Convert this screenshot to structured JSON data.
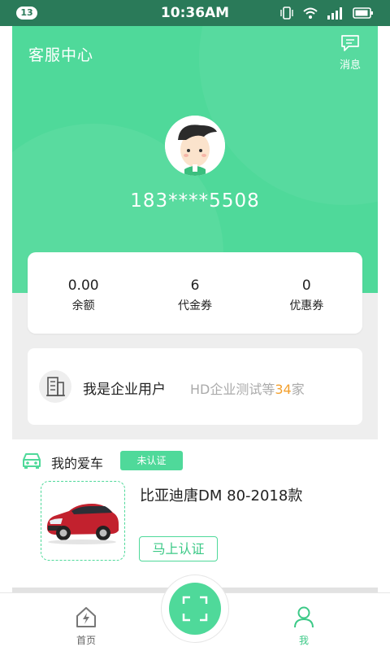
{
  "status_bar": {
    "notification_count": "13",
    "time": "10:36AM",
    "icons": [
      "vibrate-icon",
      "wifi-icon",
      "signal-icon",
      "battery-icon"
    ]
  },
  "header": {
    "service_center": "客服中心",
    "messages_label": "消息",
    "phone_masked": "183****5508",
    "background_color": "#4fd99a"
  },
  "stats": [
    {
      "value": "0.00",
      "label": "余额"
    },
    {
      "value": "6",
      "label": "代金券"
    },
    {
      "value": "0",
      "label": "优惠券"
    }
  ],
  "enterprise": {
    "title": "我是企业用户",
    "desc_prefix": "HD企业测试等",
    "count": "34",
    "desc_suffix": "家",
    "count_color": "#f3a02e"
  },
  "my_car": {
    "title": "我的爱车",
    "status_badge": "未认证",
    "model": "比亚迪唐DM 80-2018款",
    "verify_button": "马上认证"
  },
  "bottom_nav": {
    "home_label": "首页",
    "me_label": "我",
    "active": "我",
    "accent_color": "#3cc987"
  }
}
